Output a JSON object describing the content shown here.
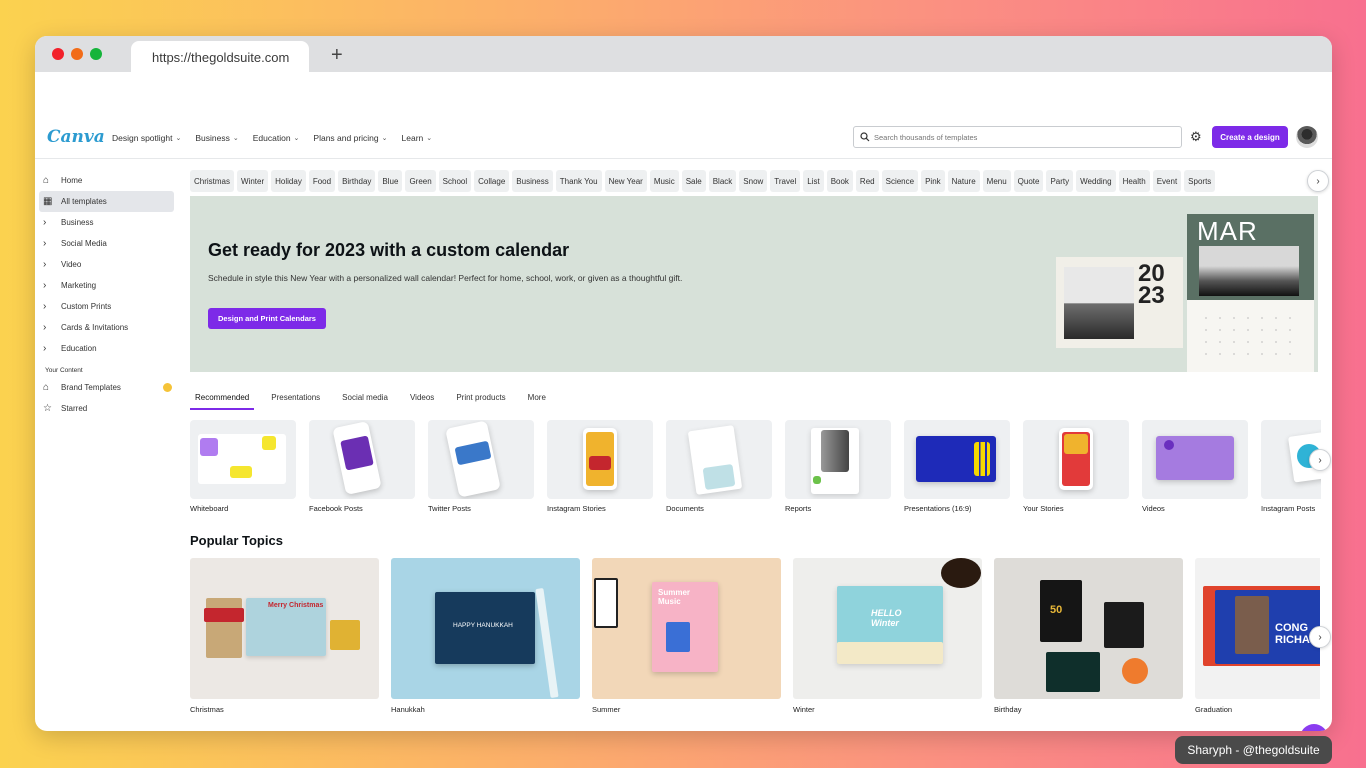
{
  "browser": {
    "url": "https://thegoldsuite.com",
    "new_tab": "+"
  },
  "app": {
    "logo": "Canva",
    "nav": [
      "Design spotlight",
      "Business",
      "Education",
      "Plans and pricing",
      "Learn"
    ],
    "search_placeholder": "Search thousands of templates",
    "create_label": "Create a design"
  },
  "sidebar": {
    "items": [
      {
        "label": "Home",
        "icon": "⌂"
      },
      {
        "label": "All templates",
        "icon": "▦"
      },
      {
        "label": "Business",
        "icon": "›"
      },
      {
        "label": "Social Media",
        "icon": "›"
      },
      {
        "label": "Video",
        "icon": "›"
      },
      {
        "label": "Marketing",
        "icon": "›"
      },
      {
        "label": "Custom Prints",
        "icon": "›"
      },
      {
        "label": "Cards & Invitations",
        "icon": "›"
      },
      {
        "label": "Education",
        "icon": "›"
      }
    ],
    "section": "Your Content",
    "brand": "Brand Templates",
    "starred": "Starred"
  },
  "chips": [
    "Christmas",
    "Winter",
    "Holiday",
    "Food",
    "Birthday",
    "Blue",
    "Green",
    "School",
    "Collage",
    "Business",
    "Thank You",
    "New Year",
    "Music",
    "Sale",
    "Black",
    "Snow",
    "Travel",
    "List",
    "Book",
    "Red",
    "Science",
    "Pink",
    "Nature",
    "Menu",
    "Quote",
    "Party",
    "Wedding",
    "Health",
    "Event",
    "Sports"
  ],
  "hero": {
    "title": "Get ready for 2023 with a custom calendar",
    "text": "Schedule in style this New Year with a personalized wall calendar! Perfect for home, school, work, or given as a thoughtful gift.",
    "button": "Design and Print Calendars",
    "year_top": "20",
    "year_bottom": "23",
    "month": "MAR"
  },
  "category_tabs": [
    "Recommended",
    "Presentations",
    "Social media",
    "Videos",
    "Print products",
    "More"
  ],
  "types": [
    "Whiteboard",
    "Facebook Posts",
    "Twitter Posts",
    "Instagram Stories",
    "Documents",
    "Reports",
    "Presentations (16:9)",
    "Your Stories",
    "Videos",
    "Instagram Posts"
  ],
  "popular": {
    "title": "Popular Topics",
    "items": [
      "Christmas",
      "Hanukkah",
      "Summer",
      "Winter",
      "Birthday",
      "Graduation"
    ],
    "card_text": {
      "christmas": "Merry Christmas",
      "hanukkah": "HAPPY HANUKKAH",
      "summer": "Summer Music",
      "winter": "HELLO Winter",
      "birthday": "50",
      "graduation": "CONG RICHA"
    }
  },
  "credit": "Sharyph - @thegoldsuite",
  "colors": {
    "accent": "#7d2ae8",
    "hero_bg": "#d7e1d9",
    "logo": "#2c9bd0"
  }
}
